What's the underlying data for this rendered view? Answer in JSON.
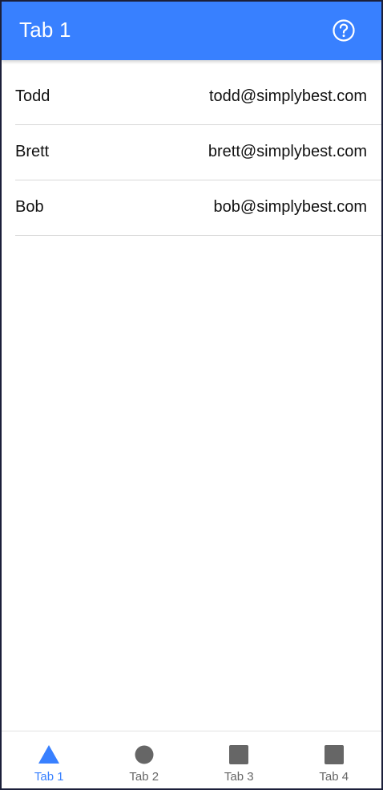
{
  "header": {
    "title": "Tab 1",
    "help_icon": "help-circle-icon"
  },
  "contacts": [
    {
      "name": "Todd",
      "email": "todd@simplybest.com"
    },
    {
      "name": "Brett",
      "email": "brett@simplybest.com"
    },
    {
      "name": "Bob",
      "email": "bob@simplybest.com"
    }
  ],
  "tabs": [
    {
      "label": "Tab 1",
      "icon": "triangle-icon",
      "active": true
    },
    {
      "label": "Tab 2",
      "icon": "ellipse-icon",
      "active": false
    },
    {
      "label": "Tab 3",
      "icon": "square-icon",
      "active": false
    },
    {
      "label": "Tab 4",
      "icon": "square-icon",
      "active": false
    }
  ],
  "colors": {
    "primary": "#3880ff",
    "inactive_icon": "#666666",
    "text": "#111111"
  }
}
